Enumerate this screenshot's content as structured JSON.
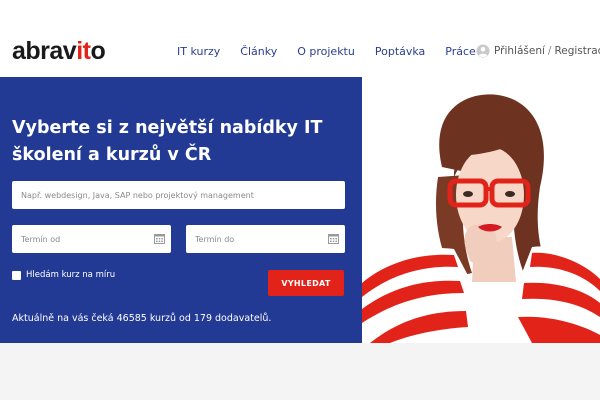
{
  "header": {
    "logo_main": "abrav",
    "logo_accent": "it",
    "logo_end": "o",
    "nav": [
      "IT kurzy",
      "Články",
      "O projektu",
      "Poptávka",
      "Práce"
    ],
    "login": "Přihlášení",
    "separator": "/",
    "register": "Registrace"
  },
  "hero": {
    "title": "Vyberte si z největší nabídky IT školení a kurzů v ČR",
    "search_placeholder": "Např. webdesign, Java, SAP nebo projektový management",
    "date_from_placeholder": "Termín od",
    "date_to_placeholder": "Termín do",
    "checkbox_label": "Hledám kurz na míru",
    "search_button": "VYHLEDAT",
    "stats": "Aktuálně na vás čeká 46585 kurzů od 179 dodavatelů."
  },
  "colors": {
    "brand_blue": "#233a95",
    "accent_red": "#e2231a",
    "nav_text": "#2b3e8f"
  },
  "icons": [
    "user-icon",
    "calendar-icon"
  ]
}
